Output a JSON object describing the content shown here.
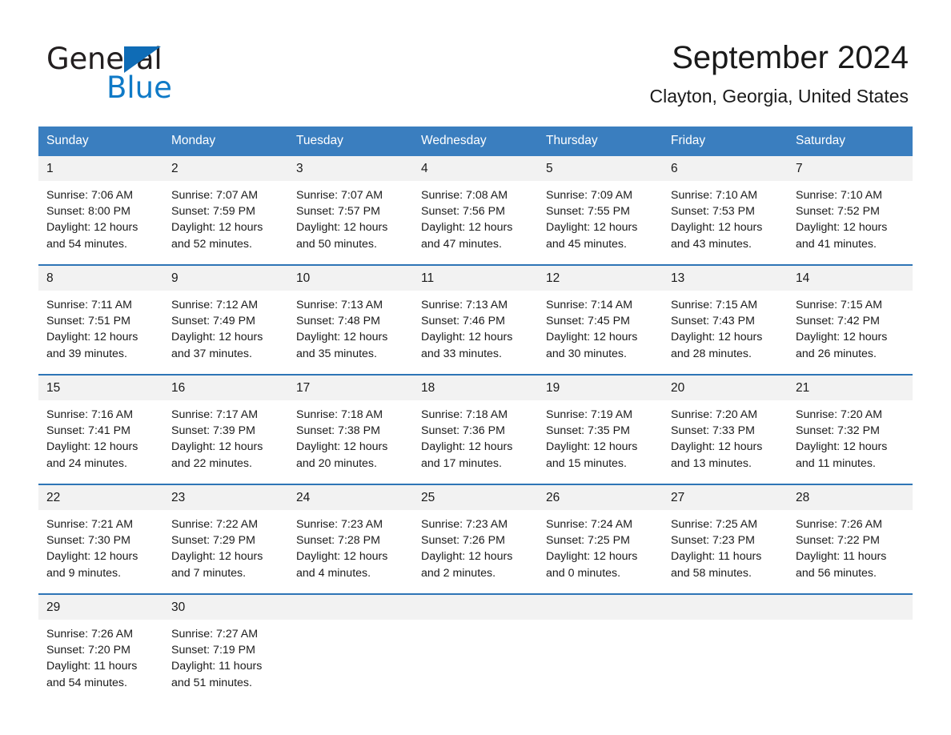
{
  "brand": {
    "name_part1": "General",
    "name_part2": "Blue",
    "triangle_color": "#0f6cb6",
    "blue_color": "#0f7ac7"
  },
  "header": {
    "title": "September 2024",
    "subtitle": "Clayton, Georgia, United States"
  },
  "theme": {
    "header_bg": "#3a7ebf",
    "row_divider": "#2e75b6",
    "daynum_bg": "#f2f2f2",
    "text": "#1a1a1a"
  },
  "columns": [
    "Sunday",
    "Monday",
    "Tuesday",
    "Wednesday",
    "Thursday",
    "Friday",
    "Saturday"
  ],
  "weeks": [
    [
      {
        "day": "1",
        "sunrise": "Sunrise: 7:06 AM",
        "sunset": "Sunset: 8:00 PM",
        "daylight_1": "Daylight: 12 hours",
        "daylight_2": "and 54 minutes."
      },
      {
        "day": "2",
        "sunrise": "Sunrise: 7:07 AM",
        "sunset": "Sunset: 7:59 PM",
        "daylight_1": "Daylight: 12 hours",
        "daylight_2": "and 52 minutes."
      },
      {
        "day": "3",
        "sunrise": "Sunrise: 7:07 AM",
        "sunset": "Sunset: 7:57 PM",
        "daylight_1": "Daylight: 12 hours",
        "daylight_2": "and 50 minutes."
      },
      {
        "day": "4",
        "sunrise": "Sunrise: 7:08 AM",
        "sunset": "Sunset: 7:56 PM",
        "daylight_1": "Daylight: 12 hours",
        "daylight_2": "and 47 minutes."
      },
      {
        "day": "5",
        "sunrise": "Sunrise: 7:09 AM",
        "sunset": "Sunset: 7:55 PM",
        "daylight_1": "Daylight: 12 hours",
        "daylight_2": "and 45 minutes."
      },
      {
        "day": "6",
        "sunrise": "Sunrise: 7:10 AM",
        "sunset": "Sunset: 7:53 PM",
        "daylight_1": "Daylight: 12 hours",
        "daylight_2": "and 43 minutes."
      },
      {
        "day": "7",
        "sunrise": "Sunrise: 7:10 AM",
        "sunset": "Sunset: 7:52 PM",
        "daylight_1": "Daylight: 12 hours",
        "daylight_2": "and 41 minutes."
      }
    ],
    [
      {
        "day": "8",
        "sunrise": "Sunrise: 7:11 AM",
        "sunset": "Sunset: 7:51 PM",
        "daylight_1": "Daylight: 12 hours",
        "daylight_2": "and 39 minutes."
      },
      {
        "day": "9",
        "sunrise": "Sunrise: 7:12 AM",
        "sunset": "Sunset: 7:49 PM",
        "daylight_1": "Daylight: 12 hours",
        "daylight_2": "and 37 minutes."
      },
      {
        "day": "10",
        "sunrise": "Sunrise: 7:13 AM",
        "sunset": "Sunset: 7:48 PM",
        "daylight_1": "Daylight: 12 hours",
        "daylight_2": "and 35 minutes."
      },
      {
        "day": "11",
        "sunrise": "Sunrise: 7:13 AM",
        "sunset": "Sunset: 7:46 PM",
        "daylight_1": "Daylight: 12 hours",
        "daylight_2": "and 33 minutes."
      },
      {
        "day": "12",
        "sunrise": "Sunrise: 7:14 AM",
        "sunset": "Sunset: 7:45 PM",
        "daylight_1": "Daylight: 12 hours",
        "daylight_2": "and 30 minutes."
      },
      {
        "day": "13",
        "sunrise": "Sunrise: 7:15 AM",
        "sunset": "Sunset: 7:43 PM",
        "daylight_1": "Daylight: 12 hours",
        "daylight_2": "and 28 minutes."
      },
      {
        "day": "14",
        "sunrise": "Sunrise: 7:15 AM",
        "sunset": "Sunset: 7:42 PM",
        "daylight_1": "Daylight: 12 hours",
        "daylight_2": "and 26 minutes."
      }
    ],
    [
      {
        "day": "15",
        "sunrise": "Sunrise: 7:16 AM",
        "sunset": "Sunset: 7:41 PM",
        "daylight_1": "Daylight: 12 hours",
        "daylight_2": "and 24 minutes."
      },
      {
        "day": "16",
        "sunrise": "Sunrise: 7:17 AM",
        "sunset": "Sunset: 7:39 PM",
        "daylight_1": "Daylight: 12 hours",
        "daylight_2": "and 22 minutes."
      },
      {
        "day": "17",
        "sunrise": "Sunrise: 7:18 AM",
        "sunset": "Sunset: 7:38 PM",
        "daylight_1": "Daylight: 12 hours",
        "daylight_2": "and 20 minutes."
      },
      {
        "day": "18",
        "sunrise": "Sunrise: 7:18 AM",
        "sunset": "Sunset: 7:36 PM",
        "daylight_1": "Daylight: 12 hours",
        "daylight_2": "and 17 minutes."
      },
      {
        "day": "19",
        "sunrise": "Sunrise: 7:19 AM",
        "sunset": "Sunset: 7:35 PM",
        "daylight_1": "Daylight: 12 hours",
        "daylight_2": "and 15 minutes."
      },
      {
        "day": "20",
        "sunrise": "Sunrise: 7:20 AM",
        "sunset": "Sunset: 7:33 PM",
        "daylight_1": "Daylight: 12 hours",
        "daylight_2": "and 13 minutes."
      },
      {
        "day": "21",
        "sunrise": "Sunrise: 7:20 AM",
        "sunset": "Sunset: 7:32 PM",
        "daylight_1": "Daylight: 12 hours",
        "daylight_2": "and 11 minutes."
      }
    ],
    [
      {
        "day": "22",
        "sunrise": "Sunrise: 7:21 AM",
        "sunset": "Sunset: 7:30 PM",
        "daylight_1": "Daylight: 12 hours",
        "daylight_2": "and 9 minutes."
      },
      {
        "day": "23",
        "sunrise": "Sunrise: 7:22 AM",
        "sunset": "Sunset: 7:29 PM",
        "daylight_1": "Daylight: 12 hours",
        "daylight_2": "and 7 minutes."
      },
      {
        "day": "24",
        "sunrise": "Sunrise: 7:23 AM",
        "sunset": "Sunset: 7:28 PM",
        "daylight_1": "Daylight: 12 hours",
        "daylight_2": "and 4 minutes."
      },
      {
        "day": "25",
        "sunrise": "Sunrise: 7:23 AM",
        "sunset": "Sunset: 7:26 PM",
        "daylight_1": "Daylight: 12 hours",
        "daylight_2": "and 2 minutes."
      },
      {
        "day": "26",
        "sunrise": "Sunrise: 7:24 AM",
        "sunset": "Sunset: 7:25 PM",
        "daylight_1": "Daylight: 12 hours",
        "daylight_2": "and 0 minutes."
      },
      {
        "day": "27",
        "sunrise": "Sunrise: 7:25 AM",
        "sunset": "Sunset: 7:23 PM",
        "daylight_1": "Daylight: 11 hours",
        "daylight_2": "and 58 minutes."
      },
      {
        "day": "28",
        "sunrise": "Sunrise: 7:26 AM",
        "sunset": "Sunset: 7:22 PM",
        "daylight_1": "Daylight: 11 hours",
        "daylight_2": "and 56 minutes."
      }
    ],
    [
      {
        "day": "29",
        "sunrise": "Sunrise: 7:26 AM",
        "sunset": "Sunset: 7:20 PM",
        "daylight_1": "Daylight: 11 hours",
        "daylight_2": "and 54 minutes."
      },
      {
        "day": "30",
        "sunrise": "Sunrise: 7:27 AM",
        "sunset": "Sunset: 7:19 PM",
        "daylight_1": "Daylight: 11 hours",
        "daylight_2": "and 51 minutes."
      },
      {
        "day": "",
        "sunrise": "",
        "sunset": "",
        "daylight_1": "",
        "daylight_2": ""
      },
      {
        "day": "",
        "sunrise": "",
        "sunset": "",
        "daylight_1": "",
        "daylight_2": ""
      },
      {
        "day": "",
        "sunrise": "",
        "sunset": "",
        "daylight_1": "",
        "daylight_2": ""
      },
      {
        "day": "",
        "sunrise": "",
        "sunset": "",
        "daylight_1": "",
        "daylight_2": ""
      },
      {
        "day": "",
        "sunrise": "",
        "sunset": "",
        "daylight_1": "",
        "daylight_2": ""
      }
    ]
  ]
}
